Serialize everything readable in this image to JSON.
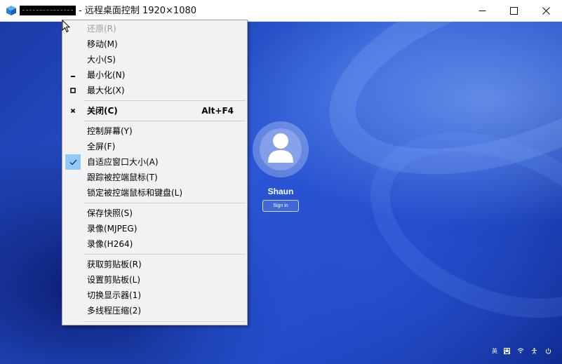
{
  "window": {
    "title": "- 远程桌面控制 1920×1080",
    "icons": {
      "app": "app-cube-icon",
      "minimize": "minimize-icon",
      "maximize": "maximize-icon",
      "close": "close-icon"
    }
  },
  "login_screen": {
    "username": "Shaun",
    "signin_label": "Sign in",
    "tray": {
      "language": "英",
      "keyboard": "keyboard-icon",
      "wifi": "wifi-icon",
      "accessibility": "accessibility-icon",
      "power": "power-icon"
    }
  },
  "menu": {
    "items": [
      {
        "label": "还原(R)",
        "state": "disabled"
      },
      {
        "label": "移动(M)"
      },
      {
        "label": "大小(S)"
      },
      {
        "label": "最小化(N)",
        "icon": "minimize-glyph-icon"
      },
      {
        "label": "最大化(X)",
        "icon": "maximize-glyph-icon"
      },
      {
        "label": "关闭(C)",
        "shortcut": "Alt+F4",
        "icon": "close-glyph-icon",
        "bold": true
      },
      {
        "label": "控制屏幕(Y)"
      },
      {
        "label": "全屏(F)"
      },
      {
        "label": "自适应窗口大小(A)",
        "checked": true,
        "icon": "checkmark-icon"
      },
      {
        "label": "跟踪被控端鼠标(T)"
      },
      {
        "label": "锁定被控端鼠标和键盘(L)"
      },
      {
        "label": "保存快照(S)"
      },
      {
        "label": "录像(MJPEG)"
      },
      {
        "label": "录像(H264)"
      },
      {
        "label": "获取剪贴板(R)"
      },
      {
        "label": "设置剪贴板(L)"
      },
      {
        "label": "切换显示器(1)"
      },
      {
        "label": "多线程压缩(2)"
      }
    ]
  },
  "colors": {
    "accent_check": "#91c9f7",
    "desktop_blue": "#1f48c2",
    "menu_bg": "#f2f2f2"
  }
}
